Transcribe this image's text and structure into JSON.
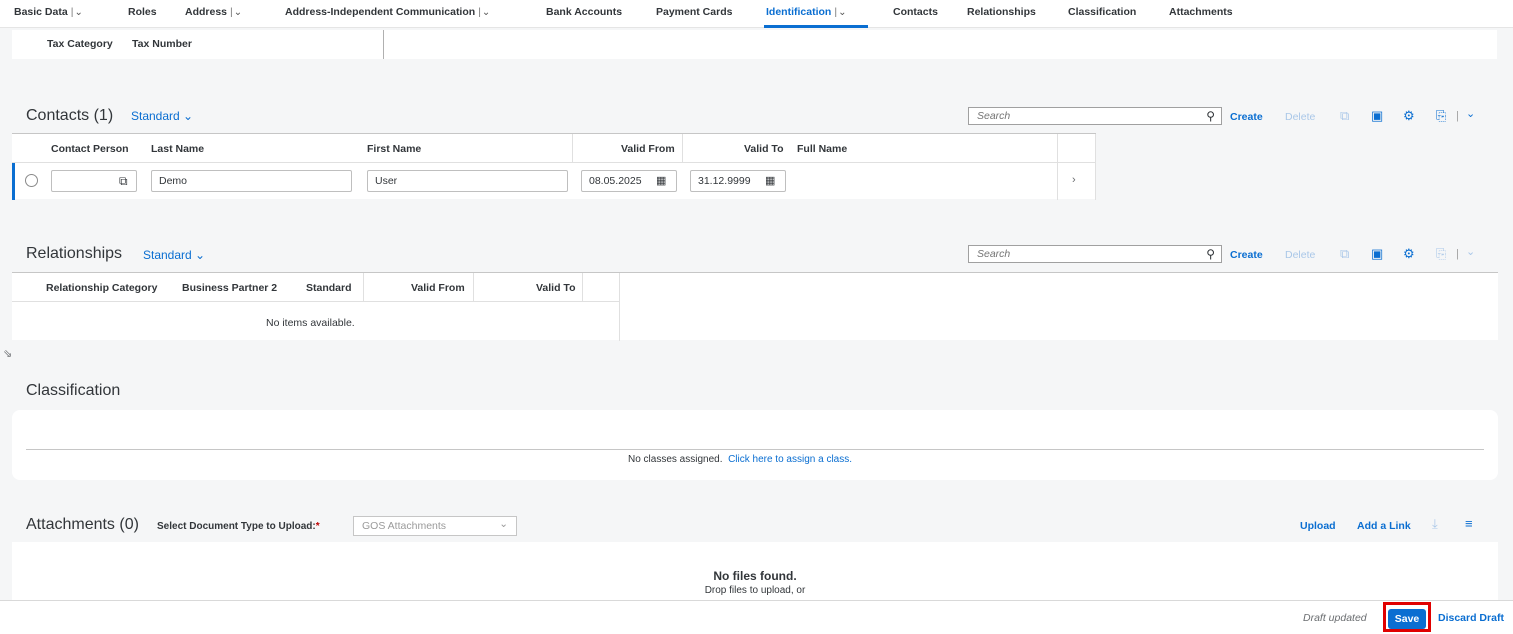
{
  "tabs": [
    {
      "label": "Basic Data",
      "has_menu": true
    },
    {
      "label": "Roles",
      "has_menu": false
    },
    {
      "label": "Address",
      "has_menu": true
    },
    {
      "label": "Address-Independent Communication",
      "has_menu": true
    },
    {
      "label": "Bank Accounts",
      "has_menu": false
    },
    {
      "label": "Payment Cards",
      "has_menu": false
    },
    {
      "label": "Identification",
      "has_menu": true,
      "active": true
    },
    {
      "label": "Contacts",
      "has_menu": false
    },
    {
      "label": "Relationships",
      "has_menu": false
    },
    {
      "label": "Classification",
      "has_menu": false
    },
    {
      "label": "Attachments",
      "has_menu": false
    }
  ],
  "tax_table": {
    "columns": [
      "Tax Category",
      "Tax Number"
    ]
  },
  "contacts": {
    "title": "Contacts (1)",
    "variant": "Standard",
    "search_placeholder": "Search",
    "toolbar": {
      "create": "Create",
      "delete": "Delete"
    },
    "columns": [
      "Contact Person",
      "Last Name",
      "First Name",
      "Valid From",
      "Valid To",
      "Full Name"
    ],
    "rows": [
      {
        "contact_person": "",
        "last_name": "Demo",
        "first_name": "User",
        "valid_from": "08.05.2025",
        "valid_to": "31.12.9999",
        "full_name": ""
      }
    ]
  },
  "relationships": {
    "title": "Relationships",
    "variant": "Standard",
    "search_placeholder": "Search",
    "toolbar": {
      "create": "Create",
      "delete": "Delete"
    },
    "columns": [
      "Relationship Category",
      "Business Partner 2",
      "Standard",
      "Valid From",
      "Valid To"
    ],
    "empty_text": "No items available."
  },
  "classification": {
    "title": "Classification",
    "empty_text": "No classes assigned.",
    "assign_link": "Click here to assign a class."
  },
  "attachments": {
    "title": "Attachments (0)",
    "doc_type_label": "Select Document Type to Upload:",
    "doc_type_value": "GOS Attachments",
    "upload": "Upload",
    "add_link": "Add a Link",
    "empty_title": "No files found.",
    "empty_hint": "Drop files to upload, or"
  },
  "footer": {
    "status": "Draft updated",
    "save": "Save",
    "discard": "Discard Draft"
  },
  "colors": {
    "accent": "#0a6ed1",
    "highlight": "#e00000"
  }
}
